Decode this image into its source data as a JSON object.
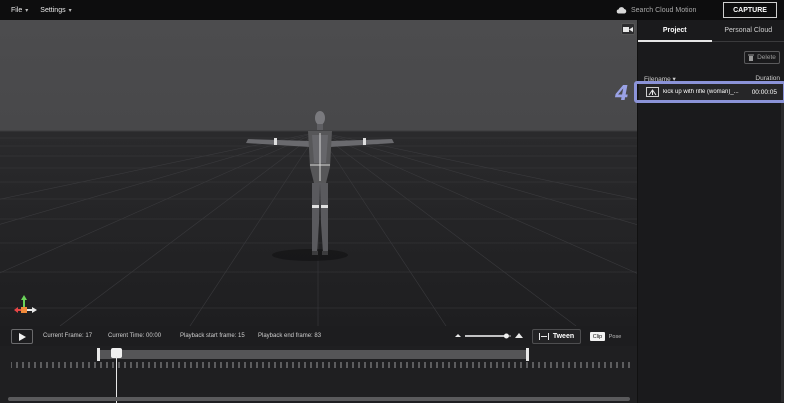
{
  "menubar": {
    "file_label": "File",
    "settings_label": "Settings",
    "search_placeholder": "Search Cloud Motion",
    "capture_label": "CAPTURE"
  },
  "panel": {
    "tabs": [
      {
        "label": "Project",
        "active": true
      },
      {
        "label": "Personal Cloud",
        "active": false
      }
    ],
    "delete_label": "Delete",
    "columns": {
      "filename": "Filename",
      "duration": "Duration"
    },
    "files": [
      {
        "name": "kick up with rifle (woman)_...",
        "duration": "00:00:05",
        "selected": true
      }
    ]
  },
  "annotation": {
    "marker": "4",
    "color": "#8b93d8"
  },
  "controls": {
    "current_frame_label": "Current Frame:",
    "current_frame": "17",
    "current_time_label": "Current Time:",
    "current_time": "00:00",
    "playback_start_label": "Playback start frame:",
    "playback_start": "15",
    "playback_end_label": "Playback end frame:",
    "playback_end": "83",
    "tween_label": "Tween",
    "mode_clip": "Clip",
    "mode_pose": "Pose",
    "zoom_level": 0.9
  },
  "colors": {
    "background": "#1c1c1e",
    "menubar": "#0d0d0e",
    "accent_highlight": "#8b93d8"
  }
}
